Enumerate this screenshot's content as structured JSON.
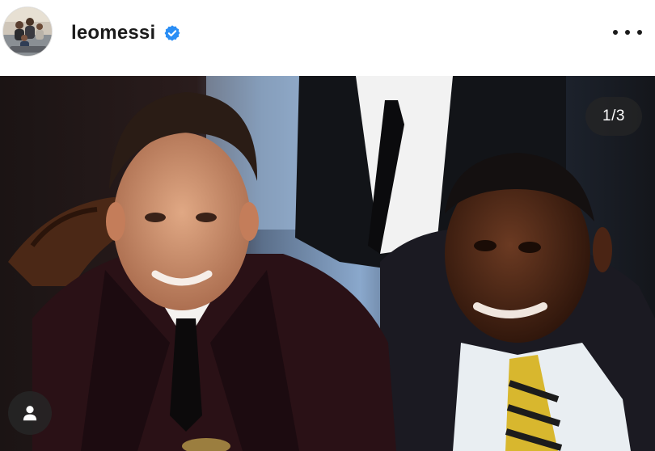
{
  "post": {
    "username": "leomessi",
    "verified": true,
    "verified_icon": "verified-badge-icon",
    "more_icon": "more-options-icon"
  },
  "media": {
    "counter": "1/3",
    "tag_icon": "user-tag-icon"
  },
  "colors": {
    "verified_blue": "#2a8ef5",
    "counter_bg": "#262626",
    "text": "#1b1b1b"
  }
}
